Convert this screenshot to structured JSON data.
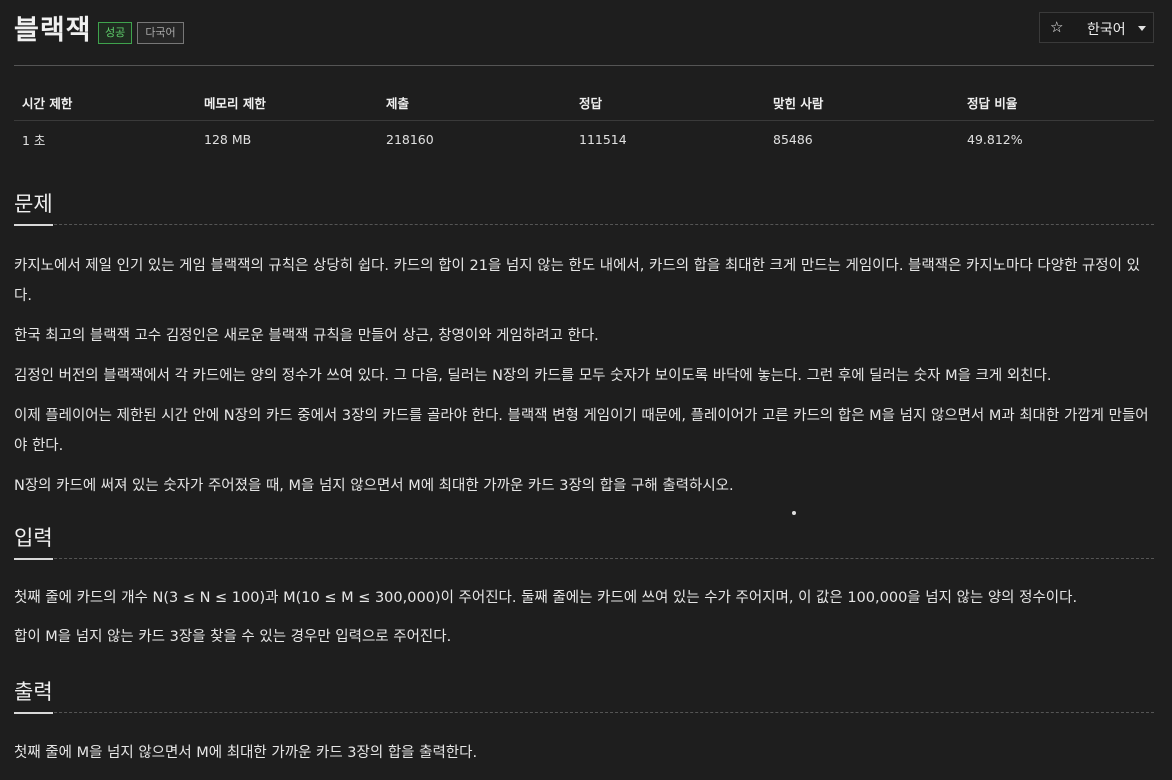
{
  "header": {
    "title": "블랙잭",
    "badges": {
      "success": "성공",
      "multilang": "다국어"
    },
    "lang_button": {
      "star_icon": "☆",
      "label": "한국어"
    }
  },
  "info_table": {
    "headers": [
      "시간 제한",
      "메모리 제한",
      "제출",
      "정답",
      "맞힌 사람",
      "정답 비율"
    ],
    "values": [
      "1 초",
      "128 MB",
      "218160",
      "111514",
      "85486",
      "49.812%"
    ]
  },
  "problem": {
    "heading": "문제",
    "paragraphs": [
      "카지노에서 제일 인기 있는 게임 블랙잭의 규칙은 상당히 쉽다. 카드의 합이 21을 넘지 않는 한도 내에서, 카드의 합을 최대한 크게 만드는 게임이다. 블랙잭은 카지노마다 다양한 규정이 있다.",
      "한국 최고의 블랙잭 고수 김정인은 새로운 블랙잭 규칙을 만들어 상근, 창영이와 게임하려고 한다.",
      "김정인 버전의 블랙잭에서 각 카드에는 양의 정수가 쓰여 있다. 그 다음, 딜러는 N장의 카드를 모두 숫자가 보이도록 바닥에 놓는다. 그런 후에 딜러는 숫자 M을 크게 외친다.",
      "이제 플레이어는 제한된 시간 안에 N장의 카드 중에서 3장의 카드를 골라야 한다. 블랙잭 변형 게임이기 때문에, 플레이어가 고른 카드의 합은 M을 넘지 않으면서 M과 최대한 가깝게 만들어야 한다.",
      "N장의 카드에 써져 있는 숫자가 주어졌을 때, M을 넘지 않으면서 M에 최대한 가까운 카드 3장의 합을 구해 출력하시오."
    ]
  },
  "input": {
    "heading": "입력",
    "paragraphs": [
      "첫째 줄에 카드의 개수 N(3 ≤ N ≤ 100)과 M(10 ≤ M ≤ 300,000)이 주어진다. 둘째 줄에는 카드에 쓰여 있는 수가 주어지며, 이 값은 100,000을 넘지 않는 양의 정수이다.",
      "합이 M을 넘지 않는 카드 3장을 찾을 수 있는 경우만 입력으로 주어진다."
    ]
  },
  "output": {
    "heading": "출력",
    "paragraphs": [
      "첫째 줄에 M을 넘지 않으면서 M에 최대한 가까운 카드 3장의 합을 출력한다."
    ]
  }
}
